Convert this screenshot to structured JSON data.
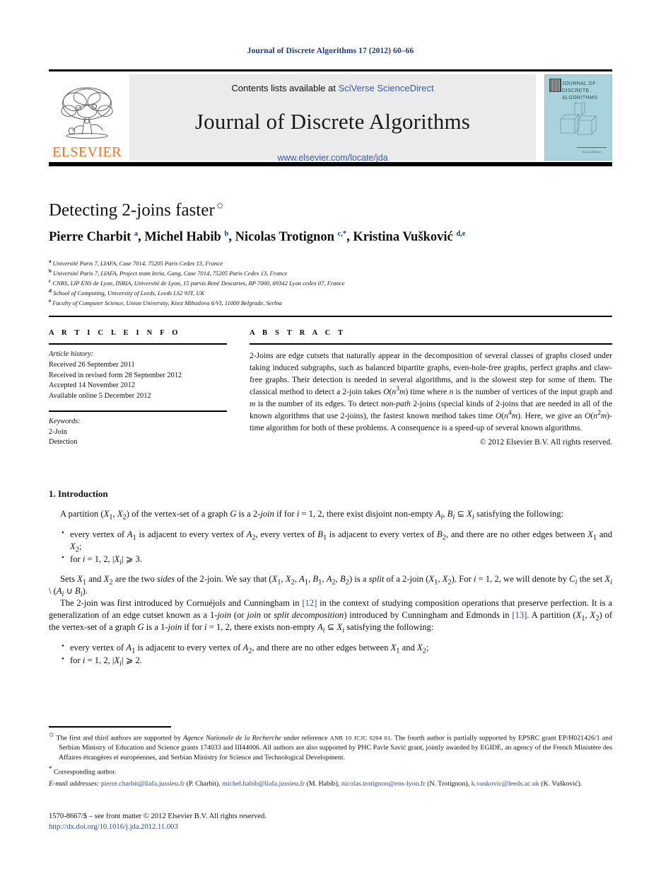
{
  "running_head": "Journal of Discrete Algorithms 17 (2012) 60–66",
  "masthead": {
    "contents_prefix": "Contents lists available at ",
    "contents_link": "SciVerse ScienceDirect",
    "journal_title": "Journal of Discrete Algorithms",
    "journal_url": "www.elsevier.com/locate/jda",
    "publisher": "ELSEVIER",
    "cover_title": "JOURNAL OF\nDISCRETE\nALGORITHMS",
    "cover_footer": "ScienceDirect",
    "cover_color": "#a8d3dd",
    "link_color": "#3b5aa6",
    "publisher_color": "#e87722"
  },
  "article": {
    "title": "Detecting 2-joins faster",
    "title_footnote_mark": "✩",
    "authors_html": "Pierre Charbit <sup>a</sup>, Michel Habib <sup>b</sup>, Nicolas Trotignon <sup>c,*</sup>, Kristina Vušković <sup>d,e</sup>",
    "affiliations": [
      {
        "mark": "a",
        "text": "Université Paris 7, LIAFA, Case 7014, 75205 Paris Cedex 13, France"
      },
      {
        "mark": "b",
        "text": "Université Paris 7, LIAFA, Project team Inria, Gang, Case 7014, 75205 Paris Cedex 13, France"
      },
      {
        "mark": "c",
        "text": "CNRS, LIP ENS de Lyon, INRIA, Université de Lyon, 15 parvis René Descartes, BP 7000, 69342 Lyon cedex 07, France"
      },
      {
        "mark": "d",
        "text": "School of Computing, University of Leeds, Leeds LS2 9JT, UK"
      },
      {
        "mark": "e",
        "text": "Faculty of Computer Science, Union University, Knez Mihailova 6/VI, 11000 Belgrade, Serbia"
      }
    ]
  },
  "info": {
    "heading": "A R T I C L E   I N F O",
    "history_label": "Article history:",
    "history": [
      "Received 26 September 2011",
      "Received in revised form 28 September 2012",
      "Accepted 14 November 2012",
      "Available online 5 December 2012"
    ],
    "keywords_label": "Keywords:",
    "keywords": [
      "2-Join",
      "Detection"
    ]
  },
  "abstract": {
    "heading": "A B S T R A C T",
    "body_html": "2-Joins are edge cutsets that naturally appear in the decomposition of several classes of graphs closed under taking induced subgraphs, such as balanced bipartite graphs, even-hole-free graphs, perfect graphs and claw-free graphs. Their detection is needed in several algorithms, and is the slowest step for some of them. The classical method to detect a 2-join takes <i>O</i>(<i>n</i><sup>3</sup><i>m</i>) time where <i>n</i> is the number of vertices of the input graph and <i>m</i> is the number of its edges. To detect <i>non-path</i> 2-joins (special kinds of 2-joins that are needed in all of the known algorithms that use 2-joins), the fastest known method takes time <i>O</i>(<i>n</i><sup>4</sup><i>m</i>). Here, we give an <i>O</i>(<i>n</i><sup>2</sup><i>m</i>)-time algorithm for both of these problems. A consequence is a speed-up of several known algorithms.",
    "copyright": "© 2012 Elsevier B.V. All rights reserved."
  },
  "body": {
    "section_title": "1. Introduction",
    "para1_html": "A partition (<i>X</i><sub>1</sub>, <i>X</i><sub>2</sub>) of the vertex-set of a graph <i>G</i> is a 2-<i>join</i> if for <i>i</i> = 1, 2, there exist disjoint non-empty <i>A<sub>i</sub></i>, <i>B<sub>i</sub></i> ⊆ <i>X<sub>i</sub></i> satisfying the following:",
    "list1": [
      "every vertex of <i>A</i><sub>1</sub> is adjacent to every vertex of <i>A</i><sub>2</sub>, every vertex of <i>B</i><sub>1</sub> is adjacent to every vertex of <i>B</i><sub>2</sub>, and there are no other edges between <i>X</i><sub>1</sub> and <i>X</i><sub>2</sub>;",
      "for <i>i</i> = 1, 2, |<i>X<sub>i</sub></i>| ⩾ 3."
    ],
    "para2_html": "Sets <i>X</i><sub>1</sub> and <i>X</i><sub>2</sub> are the two <i>sides</i> of the 2-join. We say that (<i>X</i><sub>1</sub>, <i>X</i><sub>2</sub>, <i>A</i><sub>1</sub>, <i>B</i><sub>1</sub>, <i>A</i><sub>2</sub>, <i>B</i><sub>2</sub>) is a <i>split</i> of a 2-join (<i>X</i><sub>1</sub>, <i>X</i><sub>2</sub>). For <i>i</i> = 1, 2, we will denote by <i>C<sub>i</sub></i> the set <i>X<sub>i</sub></i> \\ (<i>A<sub>i</sub></i> ∪ <i>B<sub>i</sub></i>).",
    "para3_html": "The 2-join was first introduced by Cornuéjols and Cunningham in <span class=\"reflink\">[12]</span> in the context of studying composition operations that preserve perfection. It is a generalization of an edge cutset known as a 1-<i>join</i> (or <i>join</i> or <i>split decomposition</i>) introduced by Cunningham and Edmonds in <span class=\"reflink\">[13]</span>. A partition (<i>X</i><sub>1</sub>, <i>X</i><sub>2</sub>) of the vertex-set of a graph <i>G</i> is a 1-<i>join</i> if for <i>i</i> = 1, 2, there exists non-empty <i>A<sub>i</sub></i> ⊆ <i>X<sub>i</sub></i> satisfying the following:",
    "list2": [
      "every vertex of <i>A</i><sub>1</sub> is adjacent to every vertex of <i>A</i><sub>2</sub>, and there are no other edges between <i>X</i><sub>1</sub> and <i>X</i><sub>2</sub>;",
      "for <i>i</i> = 1, 2, |<i>X<sub>i</sub></i>| ⩾ 2."
    ]
  },
  "footnotes": {
    "star_mark": "✩",
    "star_html": "The first and third authors are supported by <i>Agence Nationale de la Recherche</i> under reference <span class=\"sc\">ANR 10 JCJC 0204 01</span>. The fourth author is partially supported by EPSRC grant EP/H021426/1 and Serbian Ministry of Education and Science grants 174033 and III44006. All authors are also supported by PHC Pavle Savić grant, jointly awarded by EGIDE, an agency of the French Ministère des Affaires étrangères et européennes, and Serbian Ministry for Science and Technological Development.",
    "corresponding_mark": "*",
    "corresponding_text": "Corresponding author.",
    "email_label": "E-mail addresses:",
    "emails": [
      {
        "address": "pierre.charbit@liafa.jussieu.fr",
        "person": "(P. Charbit)"
      },
      {
        "address": "michel.habib@liafa.jussieu.fr",
        "person": "(M. Habib)"
      },
      {
        "address": "nicolas.trotignon@ens-lyon.fr",
        "person": "(N. Trotignon)"
      },
      {
        "address": "k.vuskovic@leeds.ac.uk",
        "person": "(K. Vušković)"
      }
    ]
  },
  "issn": {
    "line": "1570-8667/$ – see front matter  © 2012 Elsevier B.V. All rights reserved.",
    "doi": "http://dx.doi.org/10.1016/j.jda.2012.11.003"
  }
}
